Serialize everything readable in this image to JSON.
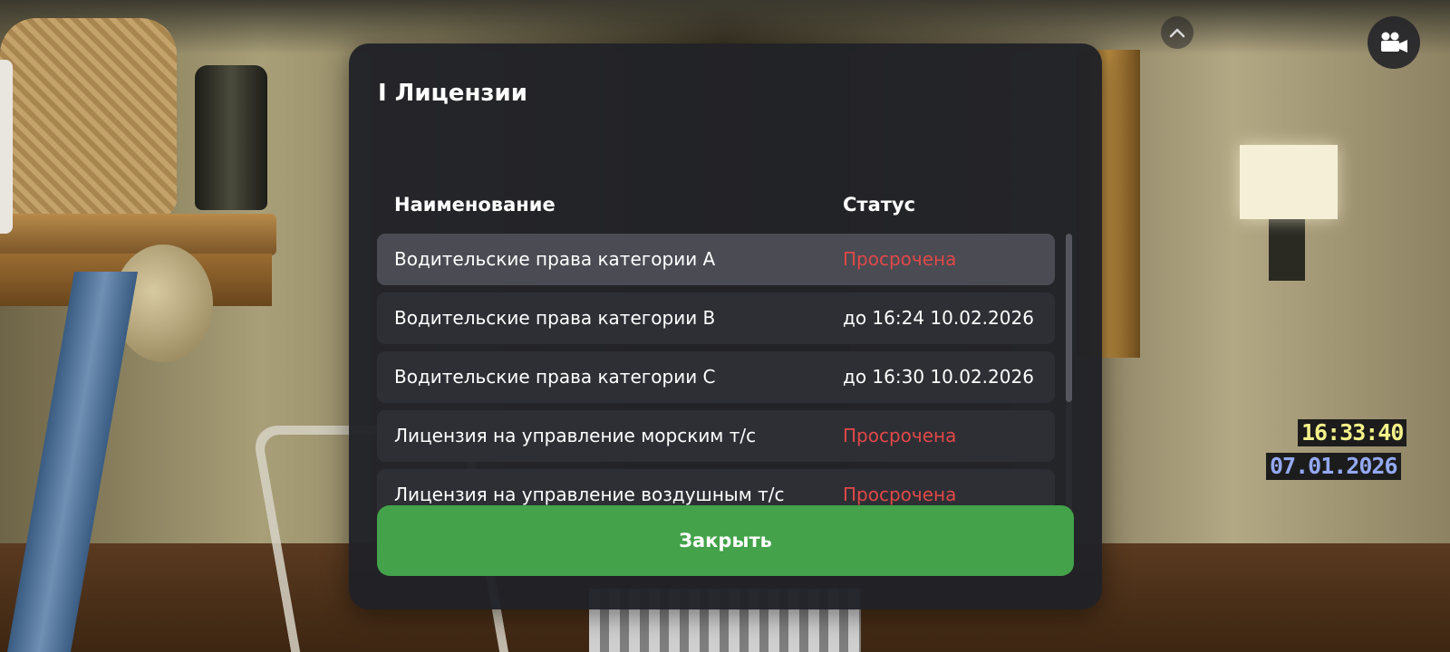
{
  "licenses_window": {
    "title": "I Лицензии",
    "columns": {
      "name": "Наименование",
      "status": "Статус"
    },
    "rows": [
      {
        "name": "Водительские права категории А",
        "status": "Просрочена",
        "expired": true,
        "selected": true
      },
      {
        "name": "Водительские права категории B",
        "status": "до 16:24 10.02.2026",
        "expired": false,
        "selected": false
      },
      {
        "name": "Водительские права категории C",
        "status": "до 16:30 10.02.2026",
        "expired": false,
        "selected": false
      },
      {
        "name": "Лицензия на управление морским т/с",
        "status": "Просрочена",
        "expired": true,
        "selected": false
      },
      {
        "name": "Лицензия на управление воздушным т/с",
        "status": "Просрочена",
        "expired": true,
        "selected": false
      }
    ],
    "close_label": "Закрыть"
  },
  "hud": {
    "time": "16:33:40",
    "date": "07.01.2026",
    "camera_icon": "video-camera-icon",
    "collapse_icon": "chevron-up-icon"
  },
  "colors": {
    "panel": "#212227",
    "row": "#2e2f35",
    "row_selected": "#4a4b53",
    "expired": "#e04848",
    "close_button": "#43a24a",
    "clock_time": "#f4f28a",
    "clock_date": "#94a9f2"
  }
}
